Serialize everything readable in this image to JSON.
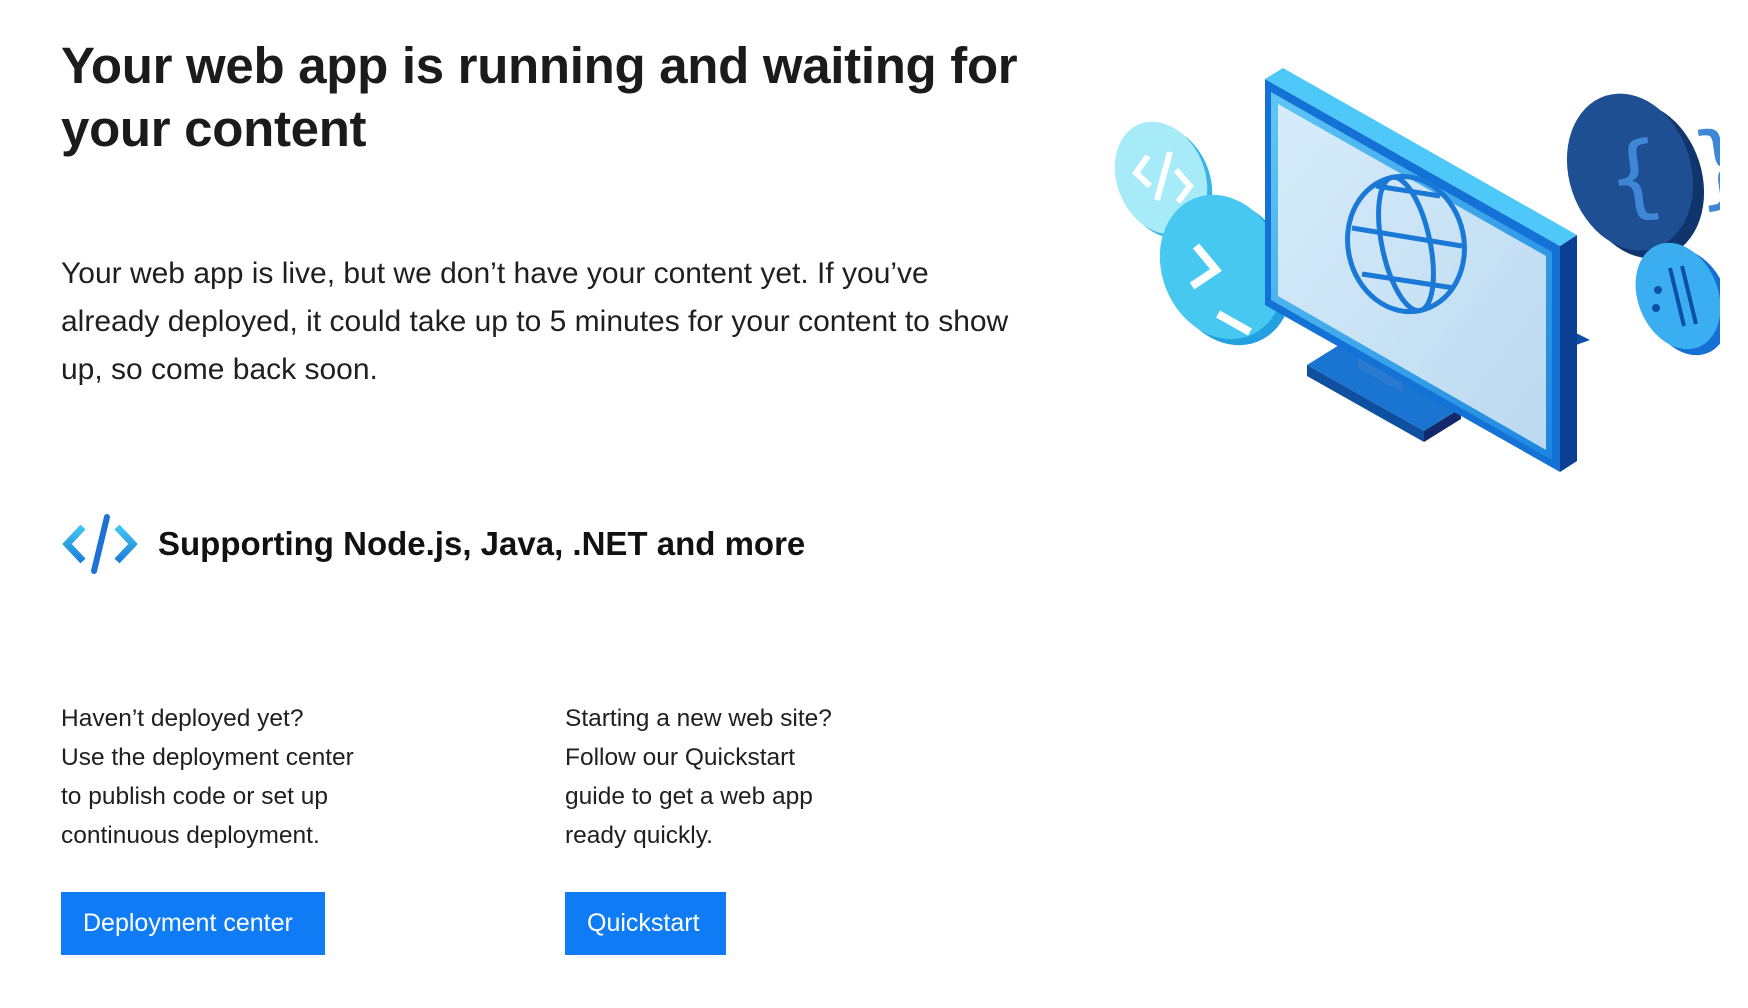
{
  "main": {
    "headline": "Your web app is running and waiting for your content",
    "intro": "Your web app is live, but we don’t have your content yet. If you’ve already deployed, it could take up to 5 minutes for your content to show up, so come back soon.",
    "supporting": {
      "icon": "code-brackets-icon",
      "label": "Supporting Node.js, Java, .NET and more"
    }
  },
  "deployment": {
    "lines": [
      "Haven’t deployed yet?",
      "Use the deployment center",
      "to publish code or set up",
      "continuous deployment."
    ],
    "button_label": "Deployment center"
  },
  "quickstart": {
    "lines": [
      "Starting a new web site?",
      "Follow our Quickstart",
      "guide to get a web app",
      "ready quickly."
    ],
    "button_label": "Quickstart"
  },
  "illustration": {
    "icons": [
      "monitor-icon",
      "globe-icon",
      "code-tag-icon",
      "terminal-icon",
      "curly-braces-icon",
      "comment-slash-icon"
    ]
  },
  "colors": {
    "button_bg": "#0f7cf5",
    "button_text": "#ffffff",
    "accent_light": "#45c8f0",
    "accent_dark": "#1c4d8c"
  }
}
